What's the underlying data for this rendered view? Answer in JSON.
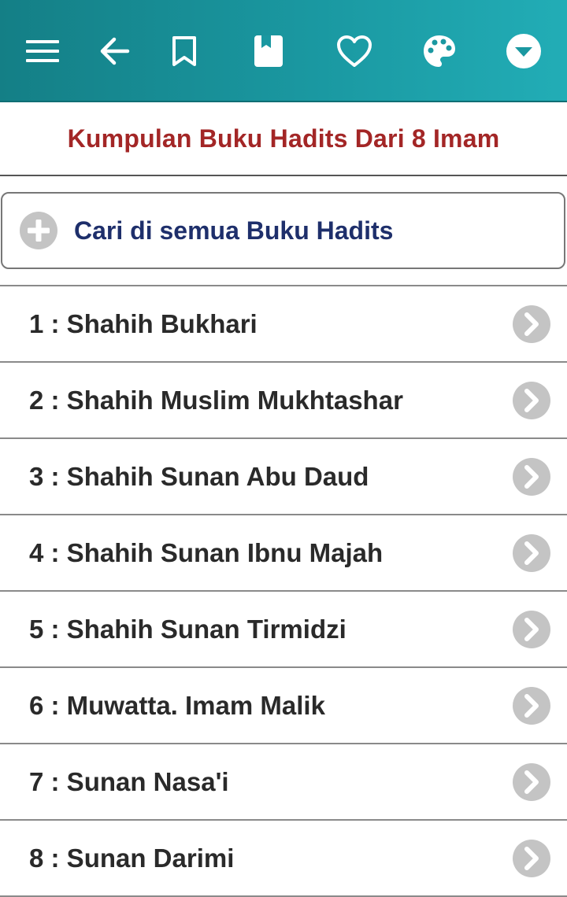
{
  "colors": {
    "toolbar": "#1a98a1",
    "title": "#a32626",
    "search_text": "#1e2f6b",
    "item_text": "#2a2a2a",
    "icon_gray": "#c4c4c4"
  },
  "toolbar": {
    "icons": [
      "menu-icon",
      "back-arrow-icon",
      "bookmark-outline-icon",
      "bookmark-filled-icon",
      "heart-icon",
      "palette-icon",
      "dropdown-circle-icon"
    ]
  },
  "header": {
    "title": "Kumpulan Buku Hadits Dari 8 Imam"
  },
  "search": {
    "label": "Cari di semua Buku Hadits"
  },
  "books": [
    {
      "label": "1 : Shahih Bukhari"
    },
    {
      "label": "2 : Shahih Muslim Mukhtashar"
    },
    {
      "label": "3 : Shahih Sunan Abu Daud"
    },
    {
      "label": "4 : Shahih Sunan Ibnu Majah"
    },
    {
      "label": "5 : Shahih Sunan Tirmidzi"
    },
    {
      "label": "6 : Muwatta. Imam Malik"
    },
    {
      "label": "7 : Sunan Nasa'i"
    },
    {
      "label": "8 : Sunan Darimi"
    }
  ]
}
